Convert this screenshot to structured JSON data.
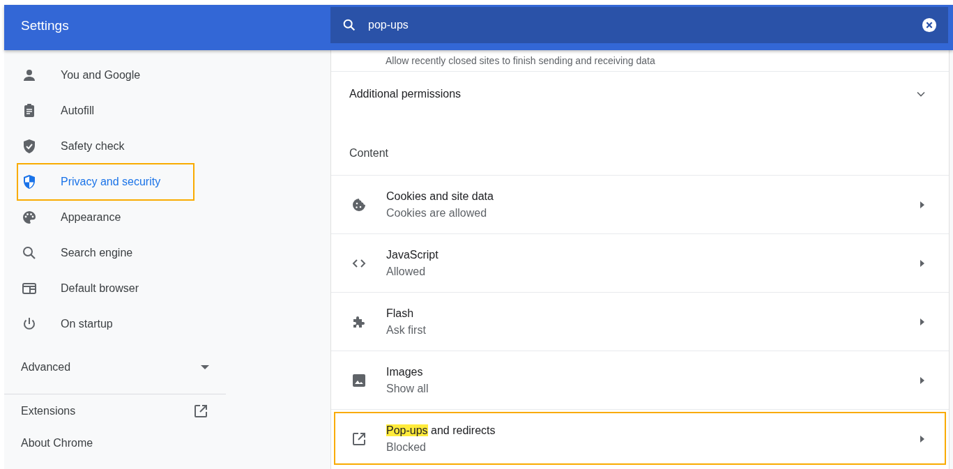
{
  "header": {
    "title": "Settings",
    "search": {
      "value": "pop-ups"
    }
  },
  "sidebar": {
    "items": [
      {
        "label": "You and Google",
        "kind": "person",
        "selected": false,
        "highlighted": false
      },
      {
        "label": "Autofill",
        "kind": "clipboard",
        "selected": false,
        "highlighted": false
      },
      {
        "label": "Safety check",
        "kind": "shield-check",
        "selected": false,
        "highlighted": false
      },
      {
        "label": "Privacy and security",
        "kind": "shield",
        "selected": true,
        "highlighted": true
      },
      {
        "label": "Appearance",
        "kind": "palette",
        "selected": false,
        "highlighted": false
      },
      {
        "label": "Search engine",
        "kind": "search",
        "selected": false,
        "highlighted": false
      },
      {
        "label": "Default browser",
        "kind": "browser",
        "selected": false,
        "highlighted": false
      },
      {
        "label": "On startup",
        "kind": "power",
        "selected": false,
        "highlighted": false
      }
    ],
    "advanced": {
      "label": "Advanced",
      "expanded": false
    },
    "links": [
      {
        "label": "Extensions",
        "external": true
      },
      {
        "label": "About Chrome",
        "external": false
      }
    ]
  },
  "content": {
    "partial_text": "Allow recently closed sites to finish sending and receiving data",
    "additional_permissions": {
      "label": "Additional permissions",
      "expanded": false
    },
    "section_title": "Content",
    "rows": [
      {
        "kind": "cookie",
        "title_parts": [
          {
            "text": "Cookies and site data",
            "match": false
          }
        ],
        "subtitle": "Cookies are allowed",
        "highlighted": false
      },
      {
        "kind": "code",
        "title_parts": [
          {
            "text": "JavaScript",
            "match": false
          }
        ],
        "subtitle": "Allowed",
        "highlighted": false
      },
      {
        "kind": "puzzle",
        "title_parts": [
          {
            "text": "Flash",
            "match": false
          }
        ],
        "subtitle": "Ask first",
        "highlighted": false
      },
      {
        "kind": "image",
        "title_parts": [
          {
            "text": "Images",
            "match": false
          }
        ],
        "subtitle": "Show all",
        "highlighted": false
      },
      {
        "kind": "external",
        "title_parts": [
          {
            "text": "Pop-ups",
            "match": true
          },
          {
            "text": " and redirects",
            "match": false
          }
        ],
        "subtitle": "Blocked",
        "highlighted": true
      }
    ]
  }
}
